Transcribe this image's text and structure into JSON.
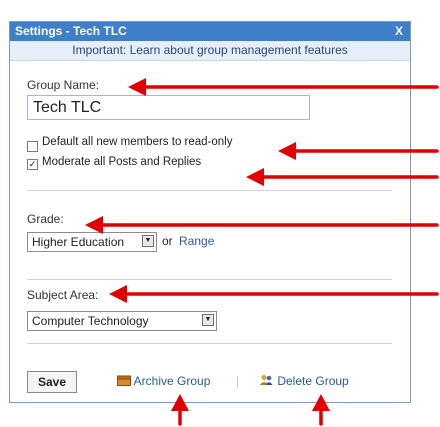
{
  "dialog": {
    "title": "Settings - Tech TLC",
    "close_label": "X",
    "banner": "Important: Learn about group management features"
  },
  "group_name": {
    "label": "Group Name:",
    "value": "Tech TLC"
  },
  "options": {
    "read_only_label": "Default all new members to read-only",
    "read_only_checked": false,
    "moderate_label": "Moderate all Posts and Replies",
    "moderate_checked": true
  },
  "grade": {
    "label": "Grade:",
    "selected": "Higher Education",
    "or_text": "or",
    "range_link": "Range"
  },
  "subject": {
    "label": "Subject Area:",
    "selected": "Computer Technology"
  },
  "actions": {
    "save": "Save",
    "archive": "Archive Group",
    "delete": "Delete Group",
    "separator": "|"
  },
  "colors": {
    "title_bar": "#3f7fc7",
    "banner_bg": "#e6eef7",
    "annotation_arrow": "#e00000",
    "link": "#2a5a9c"
  }
}
